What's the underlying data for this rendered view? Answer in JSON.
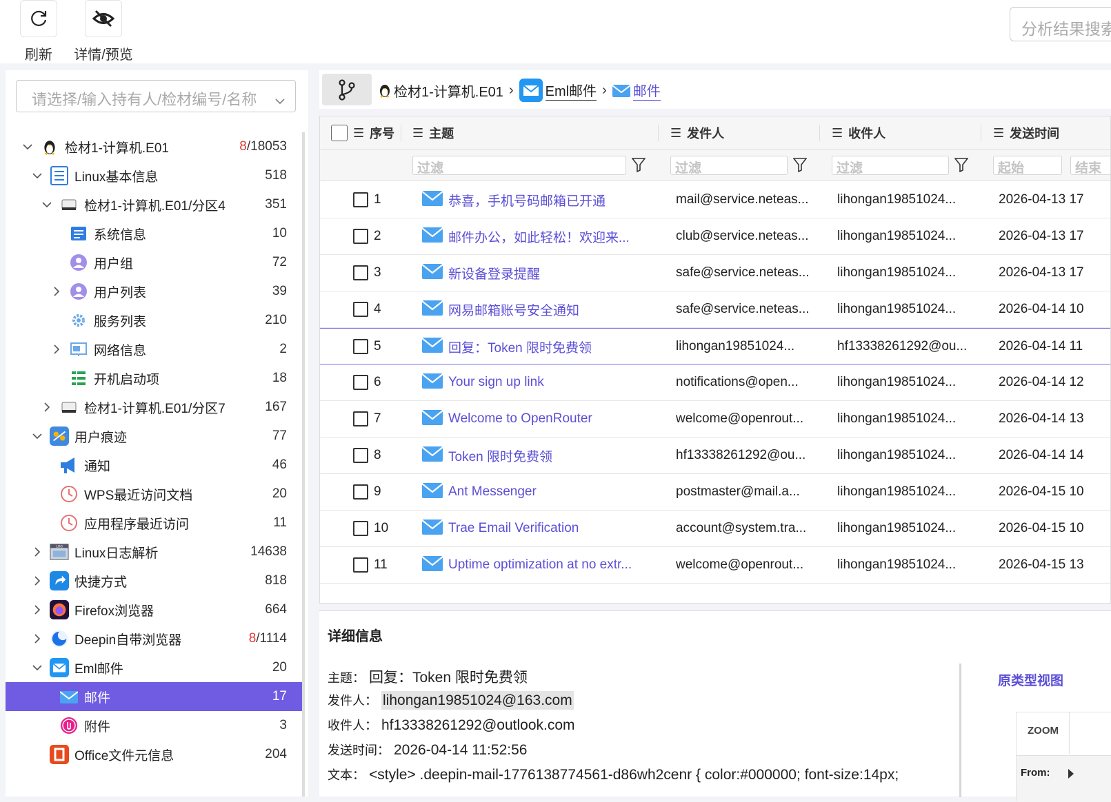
{
  "toolbar": {
    "refresh_label": "刷新",
    "preview_label": "详情/预览",
    "search_placeholder": "分析结果搜索"
  },
  "sidebar": {
    "select_placeholder": "请选择/输入持有人/检材编号/名称",
    "tree": [
      {
        "label": "检材1-计算机.E01",
        "count_red": "8",
        "count": "/18053",
        "level": 0,
        "chev": "down",
        "icon": "linux-tux-icon"
      },
      {
        "label": "Linux基本信息",
        "count": "518",
        "level": 1,
        "chev": "down",
        "icon": "list-doc-icon"
      },
      {
        "label": "检材1-计算机.E01/分区4",
        "count": "351",
        "level": 2,
        "chev": "down",
        "icon": "disk-icon"
      },
      {
        "label": "系统信息",
        "count": "10",
        "level": 3,
        "chev": "",
        "icon": "system-info-icon"
      },
      {
        "label": "用户组",
        "count": "72",
        "level": 3,
        "chev": "",
        "icon": "user-group-icon"
      },
      {
        "label": "用户列表",
        "count": "39",
        "level": 3,
        "chev": "right",
        "icon": "user-list-icon"
      },
      {
        "label": "服务列表",
        "count": "210",
        "level": 3,
        "chev": "",
        "icon": "service-gear-icon"
      },
      {
        "label": "网络信息",
        "count": "2",
        "level": 3,
        "chev": "right",
        "icon": "network-icon"
      },
      {
        "label": "开机启动项",
        "count": "18",
        "level": 3,
        "chev": "",
        "icon": "startup-icon"
      },
      {
        "label": "检材1-计算机.E01/分区7",
        "count": "167",
        "level": 2,
        "chev": "right",
        "icon": "disk-icon"
      },
      {
        "label": "用户痕迹",
        "count": "77",
        "level": 1,
        "chev": "down",
        "icon": "user-trace-icon"
      },
      {
        "label": "通知",
        "count": "46",
        "level": 2,
        "chev": "",
        "icon": "megaphone-icon"
      },
      {
        "label": "WPS最近访问文档",
        "count": "20",
        "level": 2,
        "chev": "",
        "icon": "clock-icon"
      },
      {
        "label": "应用程序最近访问",
        "count": "11",
        "level": 2,
        "chev": "",
        "icon": "clock-icon"
      },
      {
        "label": "Linux日志解析",
        "count": "14638",
        "level": 1,
        "chev": "right",
        "icon": "log-icon"
      },
      {
        "label": "快捷方式",
        "count": "818",
        "level": 1,
        "chev": "right",
        "icon": "shortcut-icon"
      },
      {
        "label": "Firefox浏览器",
        "count": "664",
        "level": 1,
        "chev": "right",
        "icon": "firefox-icon"
      },
      {
        "label": "Deepin自带浏览器",
        "count_red": "8",
        "count": "/1114",
        "level": 1,
        "chev": "right",
        "icon": "deepin-browser-icon"
      },
      {
        "label": "Eml邮件",
        "count": "20",
        "level": 1,
        "chev": "down",
        "icon": "eml-mail-icon"
      },
      {
        "label": "邮件",
        "count": "17",
        "level": 2,
        "chev": "",
        "icon": "mail-icon",
        "active": true
      },
      {
        "label": "附件",
        "count": "3",
        "level": 2,
        "chev": "",
        "icon": "attachment-icon"
      },
      {
        "label": "Office文件元信息",
        "count": "204",
        "level": 1,
        "chev": "",
        "icon": "office-icon"
      }
    ]
  },
  "breadcrumb": {
    "items": [
      "检材1-计算机.E01",
      "Eml邮件",
      "邮件"
    ]
  },
  "table": {
    "columns": {
      "seq": "序号",
      "subject": "主题",
      "sender": "发件人",
      "recipient": "收件人",
      "time": "发送时间"
    },
    "filter_placeholder": "过滤",
    "start_placeholder": "起始",
    "end_placeholder": "结束",
    "rows": [
      {
        "seq": "1",
        "subject": "恭喜，手机号码邮箱已开通",
        "sender": "mail@service.neteas...",
        "recipient": "lihongan19851024...",
        "time": "2026-04-13 17"
      },
      {
        "seq": "2",
        "subject": "邮件办公，如此轻松！欢迎来...",
        "sender": "club@service.neteas...",
        "recipient": "lihongan19851024...",
        "time": "2026-04-13 17"
      },
      {
        "seq": "3",
        "subject": "新设备登录提醒",
        "sender": "safe@service.neteas...",
        "recipient": "lihongan19851024...",
        "time": "2026-04-13 17"
      },
      {
        "seq": "4",
        "subject": "网易邮箱账号安全通知",
        "sender": "safe@service.neteas...",
        "recipient": "lihongan19851024...",
        "time": "2026-04-14 10"
      },
      {
        "seq": "5",
        "subject": "回复：Token 限时免费领",
        "sender": "lihongan19851024...",
        "recipient": "hf13338261292@ou...",
        "time": "2026-04-14 11",
        "selected": true
      },
      {
        "seq": "6",
        "subject": "Your sign up link",
        "sender": "notifications@open...",
        "recipient": "lihongan19851024...",
        "time": "2026-04-14 12"
      },
      {
        "seq": "7",
        "subject": "Welcome to OpenRouter",
        "sender": "welcome@openrout...",
        "recipient": "lihongan19851024...",
        "time": "2026-04-14 13"
      },
      {
        "seq": "8",
        "subject": "Token 限时免费领",
        "sender": "hf13338261292@ou...",
        "recipient": "lihongan19851024...",
        "time": "2026-04-14 14"
      },
      {
        "seq": "9",
        "subject": "Ant Messenger",
        "sender": "postmaster@mail.a...",
        "recipient": "lihongan19851024...",
        "time": "2026-04-15 10"
      },
      {
        "seq": "10",
        "subject": "Trae Email Verification",
        "sender": "account@system.tra...",
        "recipient": "lihongan19851024...",
        "time": "2026-04-15 10"
      },
      {
        "seq": "11",
        "subject": "Uptime optimization at no extr...",
        "sender": "welcome@openrout...",
        "recipient": "lihongan19851024...",
        "time": "2026-04-15 13"
      }
    ]
  },
  "detail": {
    "title": "详细信息",
    "subject_label": "主题：",
    "subject": "回复：Token 限时免费领",
    "sender_label": "发件人：",
    "sender": "lihongan19851024@163.com",
    "recipient_label": "收件人：",
    "recipient": "hf13338261292@outlook.com",
    "time_label": "发送时间：",
    "time": "2026-04-14 11:52:56",
    "body_label": "文本：",
    "body": "<style> .deepin-mail-1776138774561-d86wh2cenr { color:#000000; font-size:14px;",
    "raw_view_label": "原类型视图",
    "zoom_label": "ZOOM",
    "from_label": "From:"
  },
  "colors": {
    "accent": "#6f5ce3",
    "link": "#5b4fd6",
    "red_count": "#e53935"
  }
}
